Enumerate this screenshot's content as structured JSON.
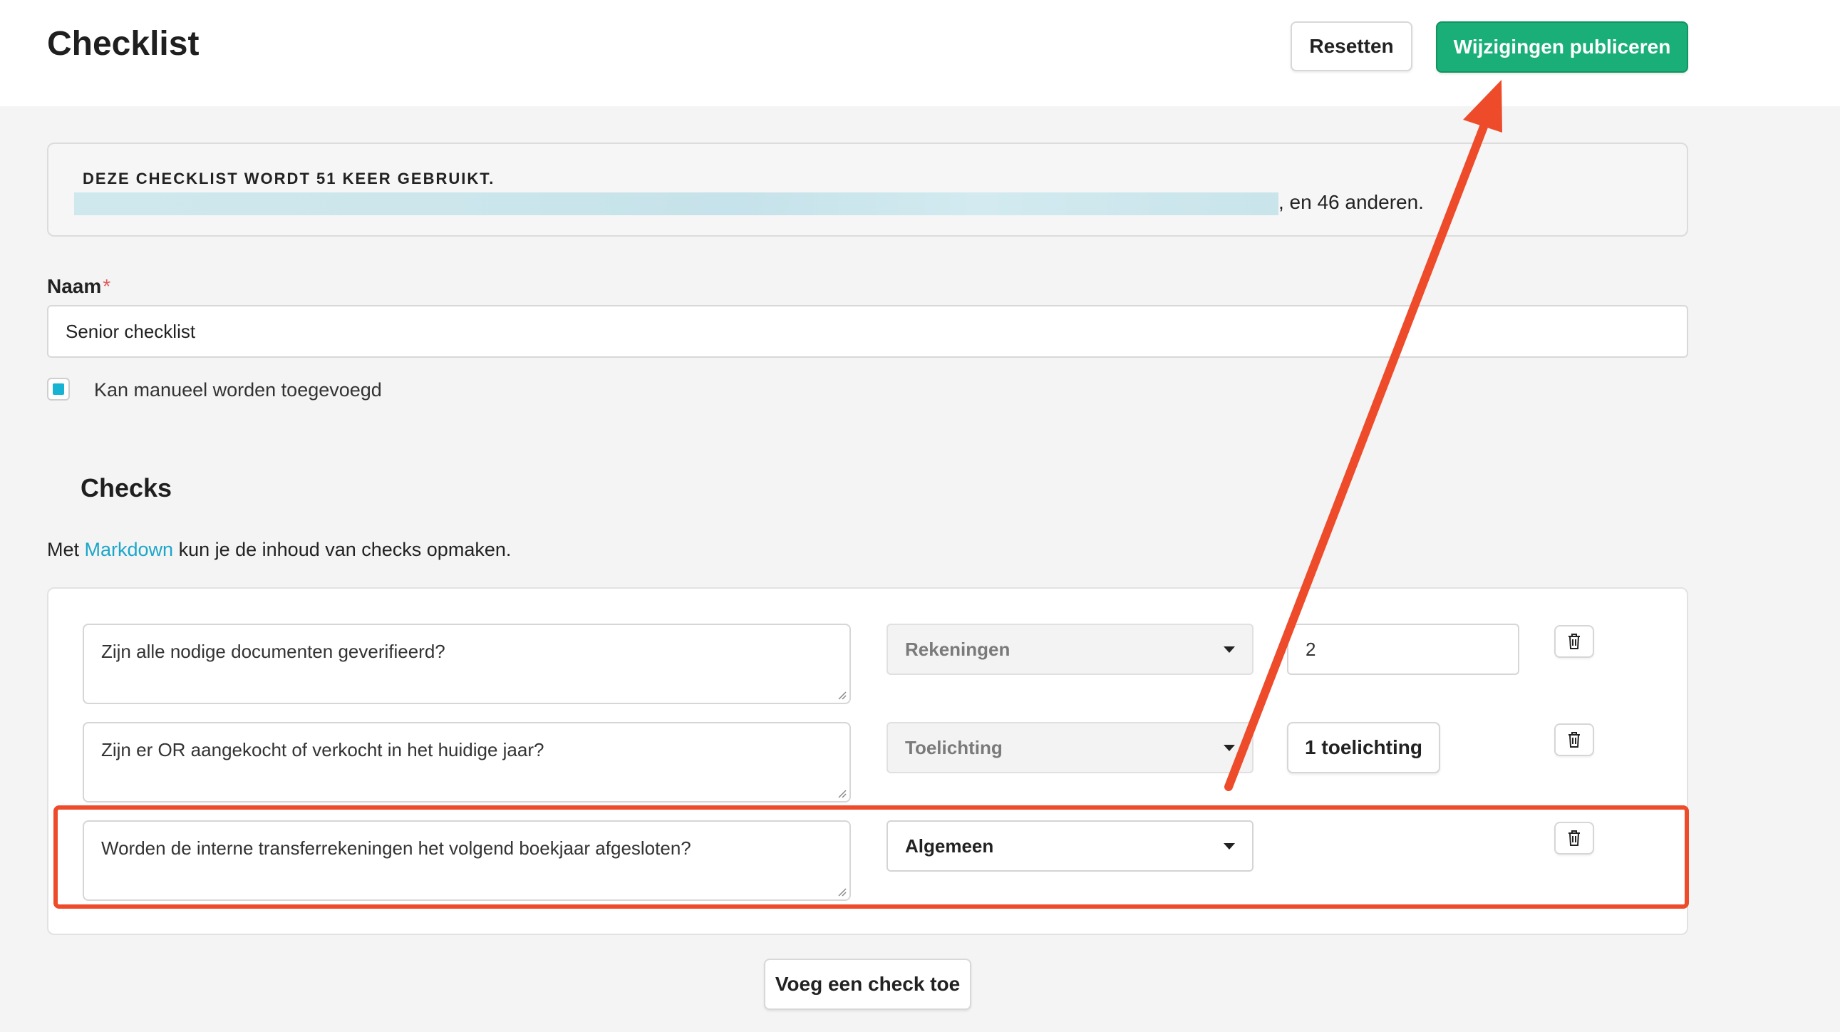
{
  "header": {
    "title": "Checklist",
    "reset_label": "Resetten",
    "publish_label": "Wijzigingen publiceren"
  },
  "usage": {
    "title": "DEZE CHECKLIST WORDT 51 KEER GEBRUIKT.",
    "rest": ", en 46 anderen."
  },
  "form": {
    "name_label": "Naam",
    "required_mark": "*",
    "name_value": "Senior checklist",
    "manual_label": "Kan manueel worden toegevoegd",
    "manual_checked": true
  },
  "checks": {
    "heading": "Checks",
    "markdown_prefix": "Met ",
    "markdown_link": "Markdown",
    "markdown_suffix": " kun je de inhoud van checks opmaken.",
    "rows": [
      {
        "text": "Zijn alle nodige documenten geverifieerd?",
        "category": "Rekeningen",
        "count_value": "2"
      },
      {
        "text": "Zijn er OR aangekocht of verkocht in het huidige jaar?",
        "category": "Toelichting",
        "explain_label": "1 toelichting"
      },
      {
        "text": "Worden de interne transferrekeningen het volgend boekjaar afgesloten?",
        "category": "Algemeen"
      }
    ],
    "add_label": "Voeg een check toe"
  },
  "colors": {
    "accent_green": "#1aaf78",
    "link_teal": "#1ca6c9",
    "checkbox_fill": "#17b3d2",
    "annotation_red": "#ee4b2b"
  }
}
